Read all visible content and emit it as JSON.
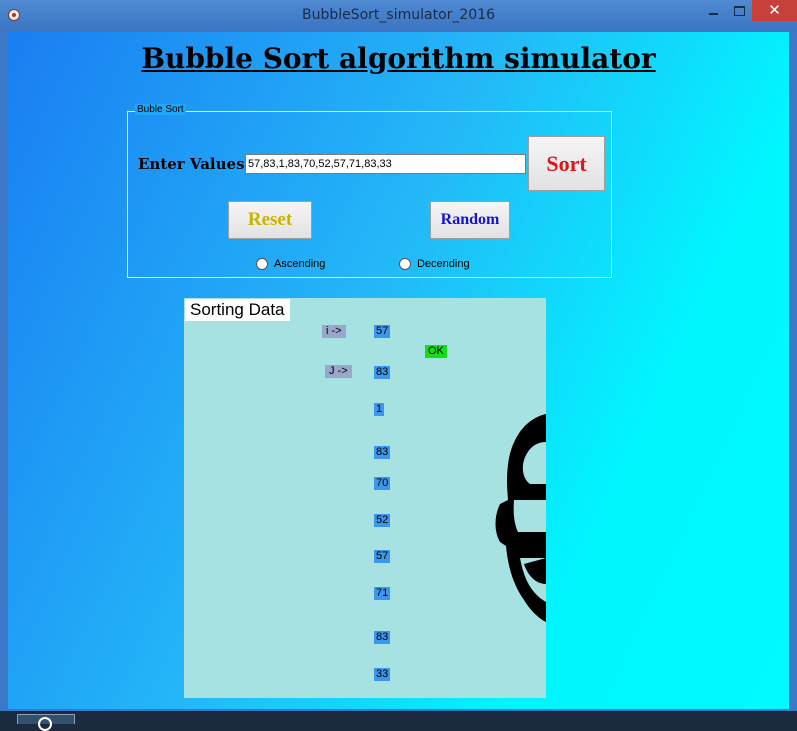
{
  "window": {
    "title": "BubbleSort_simulator_2016",
    "close_glyph": "✕",
    "icons": [
      "app-icon",
      "minimize-icon",
      "maximize-icon",
      "close-icon"
    ]
  },
  "form": {
    "heading": "Bubble Sort algorithm simulator",
    "group_caption": "Buble Sort",
    "enter_label": "Enter Values",
    "values_input": "57,83,1,83,70,52,57,71,83,33",
    "sort_button": "Sort",
    "reset_button": "Reset",
    "random_button": "Random",
    "radio_ascending": "Ascending",
    "radio_descending": "Decending"
  },
  "panel": {
    "title": "Sorting Data",
    "pointer_i": "i ->",
    "pointer_j": "J ->",
    "status": "OK",
    "values": [
      "57",
      "83",
      "1",
      "83",
      "70",
      "52",
      "57",
      "71",
      "83",
      "33"
    ]
  },
  "colors": {
    "sort_text": "#e0141a",
    "reset_text": "#c8b400",
    "random_text": "#1414d8",
    "cell_bg": "#3b97ee",
    "ok_bg": "#12e012",
    "panel_bg": "#a6e2e2"
  }
}
